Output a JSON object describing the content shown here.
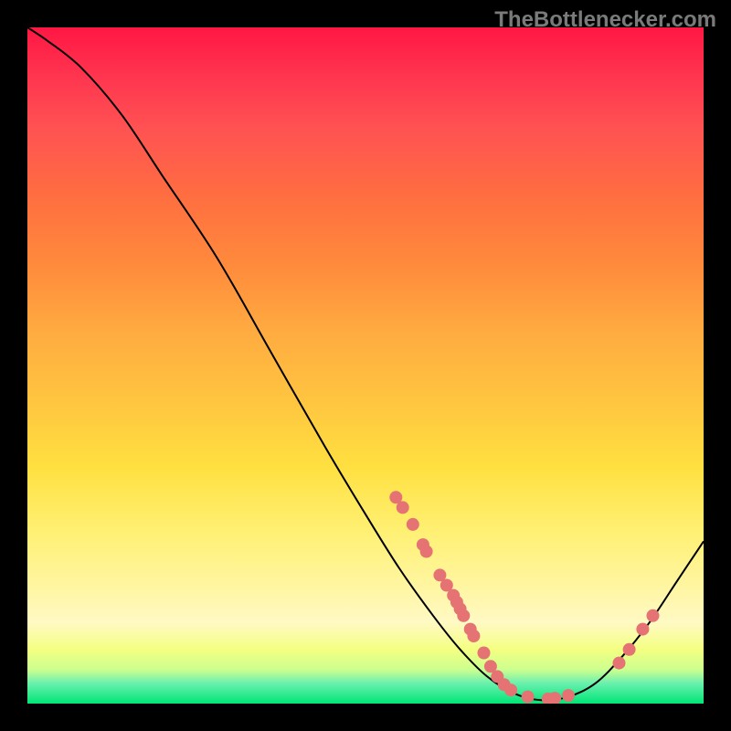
{
  "watermark": "TheBottlenecker.com",
  "chart_data": {
    "type": "line",
    "title": "",
    "xlabel": "",
    "ylabel": "",
    "xlim": [
      0,
      100
    ],
    "ylim": [
      0,
      100
    ],
    "curve": [
      {
        "x": 0,
        "y": 100
      },
      {
        "x": 3,
        "y": 98
      },
      {
        "x": 8,
        "y": 94
      },
      {
        "x": 14,
        "y": 87
      },
      {
        "x": 20,
        "y": 78
      },
      {
        "x": 28,
        "y": 66
      },
      {
        "x": 36,
        "y": 52
      },
      {
        "x": 44,
        "y": 38
      },
      {
        "x": 50,
        "y": 28
      },
      {
        "x": 55,
        "y": 20
      },
      {
        "x": 60,
        "y": 13
      },
      {
        "x": 64,
        "y": 8
      },
      {
        "x": 68,
        "y": 4
      },
      {
        "x": 72,
        "y": 1.5
      },
      {
        "x": 76,
        "y": 0.5
      },
      {
        "x": 80,
        "y": 1
      },
      {
        "x": 84,
        "y": 3
      },
      {
        "x": 88,
        "y": 7
      },
      {
        "x": 92,
        "y": 12
      },
      {
        "x": 96,
        "y": 18
      },
      {
        "x": 100,
        "y": 24
      }
    ],
    "markers": [
      {
        "x": 54.5,
        "y": 30.5
      },
      {
        "x": 55.5,
        "y": 29
      },
      {
        "x": 57,
        "y": 26.5
      },
      {
        "x": 58.5,
        "y": 23.5
      },
      {
        "x": 59,
        "y": 22.5
      },
      {
        "x": 61,
        "y": 19
      },
      {
        "x": 62,
        "y": 17.5
      },
      {
        "x": 63,
        "y": 16
      },
      {
        "x": 63.5,
        "y": 15
      },
      {
        "x": 64,
        "y": 14
      },
      {
        "x": 64.5,
        "y": 13
      },
      {
        "x": 65.5,
        "y": 11
      },
      {
        "x": 66,
        "y": 10
      },
      {
        "x": 67.5,
        "y": 7.5
      },
      {
        "x": 68.5,
        "y": 5.5
      },
      {
        "x": 69.5,
        "y": 4
      },
      {
        "x": 70.5,
        "y": 2.8
      },
      {
        "x": 71.5,
        "y": 2
      },
      {
        "x": 74,
        "y": 1
      },
      {
        "x": 77,
        "y": 0.7
      },
      {
        "x": 78,
        "y": 0.8
      },
      {
        "x": 80,
        "y": 1.2
      },
      {
        "x": 87.5,
        "y": 6
      },
      {
        "x": 89,
        "y": 8
      },
      {
        "x": 91,
        "y": 11
      },
      {
        "x": 92.5,
        "y": 13
      }
    ],
    "marker_color": "#e57373"
  }
}
